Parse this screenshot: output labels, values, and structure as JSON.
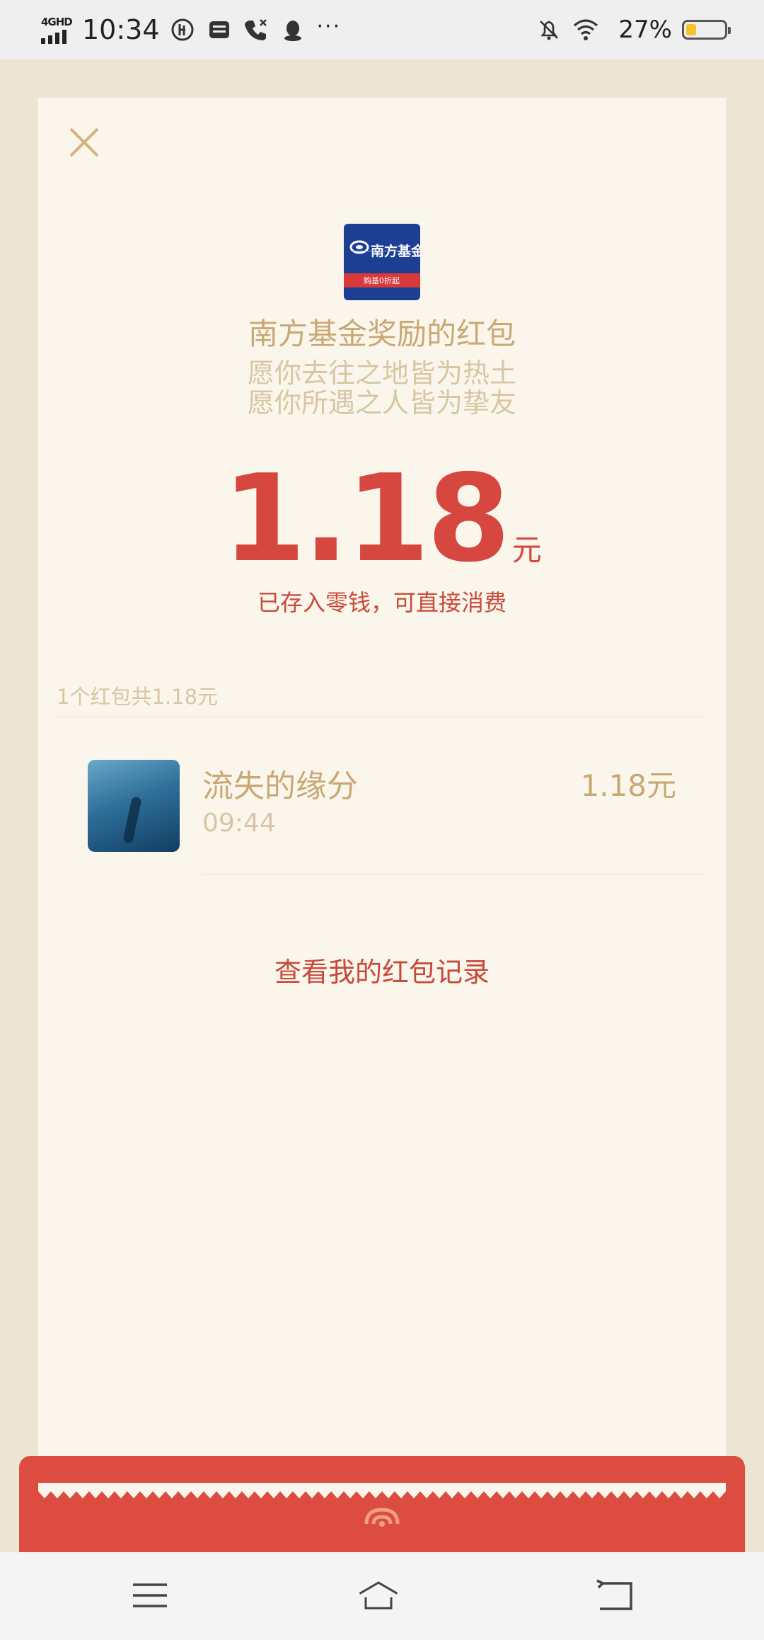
{
  "status_bar": {
    "network": "4GHD",
    "time": "10:34",
    "battery_percent": "27%",
    "battery_level": 0.27,
    "icons": [
      "signal-icon",
      "sync-icon",
      "message-icon",
      "phone-icon",
      "qq-penguin-icon",
      "more-dots-icon",
      "mute-bell-icon",
      "wifi-icon",
      "battery-icon"
    ],
    "more": "···"
  },
  "red_packet": {
    "sender_title": "南方基金奖励的红包",
    "wish_line1": "愿你去往之地皆为热土",
    "wish_line2": "愿你所遇之人皆为挚友",
    "amount": "1.18",
    "unit": "元",
    "stored_note": "已存入零钱，可直接消费",
    "logo": {
      "name": "南方基金",
      "band_text": "购基0折起"
    },
    "summary": "1个红包共1.18元",
    "receivers": [
      {
        "name": "流失的缘分",
        "time": "09:44",
        "amount": "1.18元"
      }
    ],
    "records_link": "查看我的红包记录"
  },
  "colors": {
    "background": "#ede5d4",
    "card": "#fbf6ec",
    "gold": "#c9a874",
    "red": "#d6483f",
    "envelope": "#dc4c41"
  },
  "navbar": {
    "icons": [
      "menu-icon",
      "home-icon",
      "back-icon"
    ]
  }
}
